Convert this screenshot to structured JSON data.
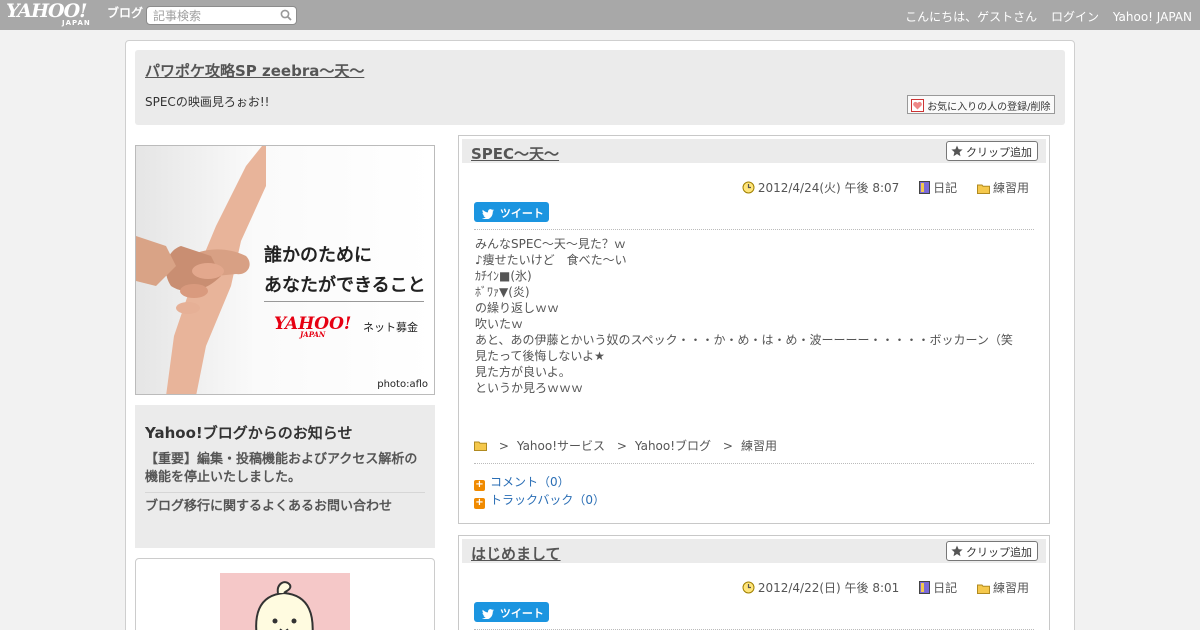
{
  "topbar": {
    "logo": "YAHOO!",
    "logo_sub": "JAPAN",
    "logo_blog": "ブログ",
    "search_placeholder": "記事検索",
    "greeting": "こんにちは、ゲストさん",
    "login": "ログイン",
    "yahoo_japan": "Yahoo! JAPAN"
  },
  "blog": {
    "title": "パワポケ攻略SP zeebra～天～",
    "description": "SPECの映画見ろぉお!!",
    "fav_button": "お気に入りの人の登録/削除"
  },
  "ad": {
    "line1": "誰かのために",
    "line2": "あなたができること",
    "logo": "YAHOO!",
    "logo_sub": "JAPAN",
    "service": "ネット募金",
    "photo_credit": "photo:aflo"
  },
  "notice": {
    "heading": "Yahoo!ブログからのお知らせ",
    "items": [
      "【重要】編集・投稿機能およびアクセス解析の機能を停止いたしました。",
      "ブログ移行に関するよくあるお問い合わせ"
    ]
  },
  "articles": [
    {
      "title": "SPEC～天～",
      "clip": "クリップ追加",
      "date": "2012/4/24(火) 午後 8:07",
      "category": "日記",
      "folder": "練習用",
      "tweet": "ツイート",
      "body": [
        "みんなSPEC～天～見た？ｗ",
        "♪痩せたいけど　食べた～い",
        "ｶﾁｲﾝ■(氷)",
        "ﾎﾞﾜｧ▼(炎)",
        "の繰り返しｗｗ",
        "吹いたｗ",
        "あと、あの伊藤とかいう奴のスペック・・・か・め・は・め・波ーーーー・・・・・ボッカーン（笑",
        "見たって後悔しないよ★",
        "見た方が良いよ。",
        "というか見ろｗｗｗ"
      ],
      "breadcrumb": [
        "Yahoo!サービス",
        "Yahoo!ブログ",
        "練習用"
      ],
      "breadcrumb_sep": ">",
      "comments": "コメント（0）",
      "trackbacks": "トラックバック（0）"
    },
    {
      "title": "はじめまして",
      "clip": "クリップ追加",
      "date": "2012/4/22(日) 午後 8:01",
      "category": "日記",
      "folder": "練習用",
      "tweet": "ツイート"
    }
  ],
  "colors": {
    "topbar": "#a8a8a8",
    "link_blue": "#2a6eb5",
    "tweet_blue": "#1b95e0",
    "header_gray": "#ebebeb",
    "orange": "#f08a00"
  }
}
